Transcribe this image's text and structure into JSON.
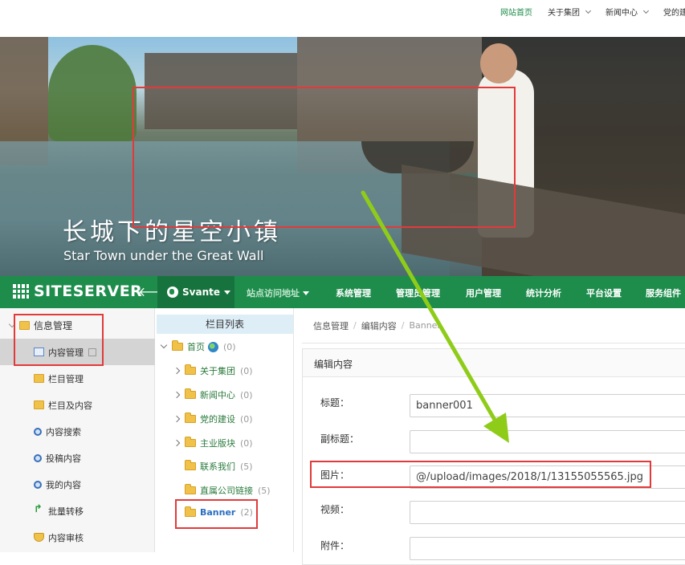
{
  "site_nav": {
    "items": [
      {
        "label": "网站首页",
        "active": true,
        "dropdown": false
      },
      {
        "label": "关于集团",
        "active": false,
        "dropdown": true
      },
      {
        "label": "新闻中心",
        "active": false,
        "dropdown": true
      },
      {
        "label": "党的建",
        "active": false,
        "dropdown": false
      }
    ]
  },
  "banner": {
    "title": "长城下的星空小镇",
    "subtitle": "Star Town under the Great Wall"
  },
  "admin_bar": {
    "brand": "SITESERVER",
    "back_icon": "arrow-left-icon",
    "site_name": "Svante",
    "menus": [
      {
        "label": "站点访问地址",
        "dropdown": true,
        "dimmed": true
      },
      {
        "label": "系统管理",
        "dropdown": false,
        "dimmed": false
      },
      {
        "label": "管理员管理",
        "dropdown": false,
        "dimmed": false
      },
      {
        "label": "用户管理",
        "dropdown": false,
        "dimmed": false
      },
      {
        "label": "统计分析",
        "dropdown": false,
        "dimmed": false
      },
      {
        "label": "平台设置",
        "dropdown": false,
        "dimmed": false
      },
      {
        "label": "服务组件",
        "dropdown": false,
        "dimmed": false
      }
    ],
    "color": "#1e8d4c"
  },
  "sidebar": {
    "group": "信息管理",
    "items": [
      {
        "label": "内容管理",
        "icon": "document-icon",
        "active": true
      },
      {
        "label": "栏目管理",
        "icon": "folder-icon",
        "active": false
      },
      {
        "label": "栏目及内容",
        "icon": "folder-icon",
        "active": false
      },
      {
        "label": "内容搜索",
        "icon": "search-icon",
        "active": false
      },
      {
        "label": "投稿内容",
        "icon": "search-icon",
        "active": false
      },
      {
        "label": "我的内容",
        "icon": "search-icon",
        "active": false
      },
      {
        "label": "批量转移",
        "icon": "transfer-icon",
        "active": false
      },
      {
        "label": "内容审核",
        "icon": "shield-icon",
        "active": false
      }
    ]
  },
  "tree": {
    "header": "栏目列表",
    "root": {
      "label": "首页",
      "count": "(0)"
    },
    "children": [
      {
        "label": "关于集团",
        "count": "(0)",
        "expandable": true
      },
      {
        "label": "新闻中心",
        "count": "(0)",
        "expandable": true
      },
      {
        "label": "党的建设",
        "count": "(0)",
        "expandable": true
      },
      {
        "label": "主业版块",
        "count": "(0)",
        "expandable": true
      },
      {
        "label": "联系我们",
        "count": "(5)",
        "expandable": false
      },
      {
        "label": "直属公司链接",
        "count": "(5)",
        "expandable": false
      },
      {
        "label": "Banner",
        "count": "(2)",
        "expandable": false
      }
    ]
  },
  "breadcrumb": [
    "信息管理",
    "编辑内容",
    "Banner"
  ],
  "form": {
    "heading": "编辑内容",
    "fields": [
      {
        "label": "标题：",
        "value": "banner001"
      },
      {
        "label": "副标题：",
        "value": ""
      },
      {
        "label": "图片：",
        "value": "@/upload/images/2018/1/13155055565.jpg"
      },
      {
        "label": "视频：",
        "value": ""
      },
      {
        "label": "附件：",
        "value": ""
      }
    ]
  }
}
